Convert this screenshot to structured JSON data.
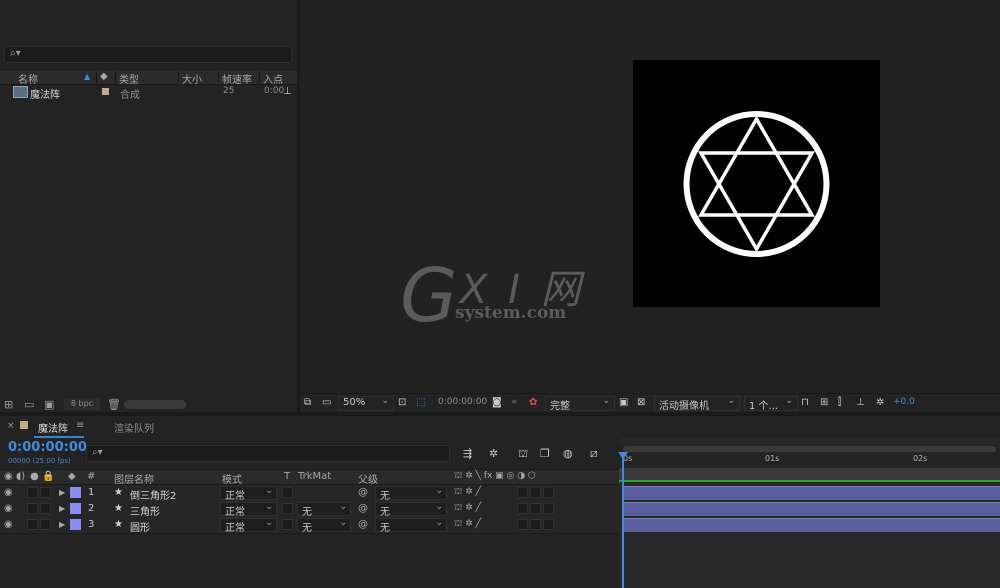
{
  "project": {
    "search_glyph": "⌕▾",
    "columns": {
      "name": "名称",
      "type": "类型",
      "size": "大小",
      "fps": "帧速率",
      "in_point": "入点"
    },
    "items": [
      {
        "name": "魔法阵",
        "type": "合成",
        "fps": "25",
        "in_point": "0:00"
      }
    ],
    "bpc": "8 bpc"
  },
  "viewer_toolbar": {
    "zoom": "50%",
    "timecode": "0:00:00:00",
    "resolution": "完整",
    "camera": "活动摄像机",
    "views": "1 个...",
    "exposure": "+0.0"
  },
  "timeline": {
    "tab_comp": "魔法阵",
    "tab_render": "渲染队列",
    "timecode": "0:00:00:00",
    "fps_readout": "00000 (25.00 fps)",
    "columns": {
      "number": "#",
      "layer_name": "图层名称",
      "mode": "模式",
      "t": "T",
      "trkmat": "TrkMat",
      "parent": "父级"
    },
    "ruler": {
      "t0": "0s",
      "t1": "01s",
      "t2": "02s"
    },
    "layers": [
      {
        "num": "1",
        "name": "倒三角形2",
        "mode": "正常",
        "trkmat": "",
        "parent": "无"
      },
      {
        "num": "2",
        "name": "三角形",
        "mode": "正常",
        "trkmat": "无",
        "parent": "无"
      },
      {
        "num": "3",
        "name": "圆形",
        "mode": "正常",
        "trkmat": "无",
        "parent": "无"
      }
    ]
  },
  "watermark": {
    "g": "G",
    "xi": "X I 网",
    "site": "system.com"
  },
  "colors": {
    "accent": "#3f8bdf",
    "label": "#8a8cf2",
    "bar": "#5a5e9c",
    "panel": "#232323"
  }
}
